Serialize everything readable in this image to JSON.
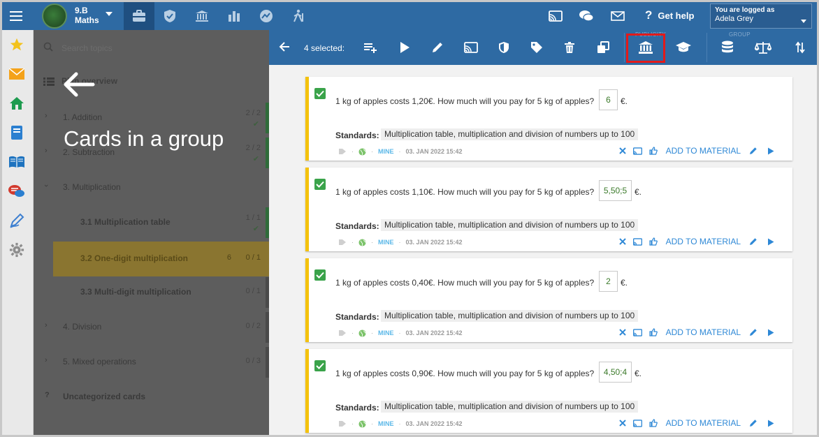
{
  "header": {
    "class_name_line1": "9.B",
    "class_name_line2": "Maths",
    "get_help": "Get help",
    "user_label": "You are logged as",
    "user_name": "Adela Grey"
  },
  "topics": {
    "search_placeholder": "Search topics",
    "overview_label": "Plan overview",
    "rows": [
      {
        "label": "1. Addition",
        "count": "2 / 2",
        "check": "✔"
      },
      {
        "label": "2. Subtraction",
        "count": "2 / 2",
        "check": "✔"
      },
      {
        "label": "3. Multiplication",
        "count": ""
      },
      {
        "label": "3.1  Multiplication table",
        "count": "1 / 1",
        "check": "✔"
      },
      {
        "label": "3.2  One-digit multiplication",
        "count": "0 / 1",
        "extra": "6"
      },
      {
        "label": "3.3  Multi-digit multiplication",
        "count": "0 / 1"
      },
      {
        "label": "4. Division",
        "count": "0 / 2"
      },
      {
        "label": "5. Mixed operations",
        "count": "0 / 3"
      },
      {
        "label": "Uncategorized cards",
        "count": "",
        "prefix": "?"
      }
    ]
  },
  "overlay": {
    "title": "Cards in a group"
  },
  "toolbar": {
    "selected_text": "4 selected:",
    "group_publicity": "PUBLICITY",
    "group_group": "GROUP"
  },
  "cards": [
    {
      "question": "1 kg of apples costs 1,20€. How much will you pay for 5 kg of apples?",
      "answer": "6",
      "unit": "€.",
      "standards_label": "Standards:",
      "standards": "Multiplication table, multiplication and division of numbers up to 100",
      "owner": "MINE",
      "date": "03. JAN 2022 15:42",
      "add_label": "ADD TO MATERIAL"
    },
    {
      "question": "1 kg of apples costs 1,10€. How much will you pay for 5 kg of apples?",
      "answer": "5,50;5",
      "unit": "€.",
      "standards_label": "Standards:",
      "standards": "Multiplication table, multiplication and division of numbers up to 100",
      "owner": "MINE",
      "date": "03. JAN 2022 15:42",
      "add_label": "ADD TO MATERIAL"
    },
    {
      "question": "1 kg of apples costs 0,40€. How much will you pay for 5 kg of apples?",
      "answer": "2",
      "unit": "€.",
      "standards_label": "Standards:",
      "standards": "Multiplication table, multiplication and division of numbers up to 100",
      "owner": "MINE",
      "date": "03. JAN 2022 15:42",
      "add_label": "ADD TO MATERIAL"
    },
    {
      "question": "1 kg of apples costs 0,90€. How much will you pay for 5 kg of apples?",
      "answer": "4,50;4",
      "unit": "€.",
      "standards_label": "Standards:",
      "standards": "Multiplication table, multiplication and division of numbers up to 100",
      "owner": "MINE",
      "date": "03. JAN 2022 15:42",
      "add_label": "ADD TO MATERIAL"
    }
  ]
}
